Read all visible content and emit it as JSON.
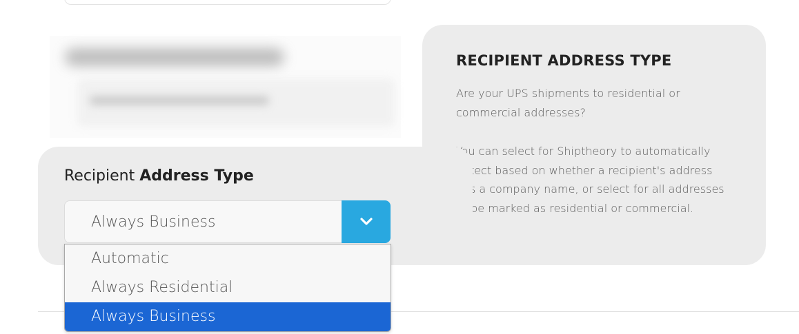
{
  "help": {
    "title": "RECIPIENT ADDRESS TYPE",
    "paragraph1": "Are your UPS shipments to residential or commercial addresses?",
    "paragraph2": "You can select for Shiptheory to automatically detect based on whether a recipient's address has a company name, or select for all addresses to be marked as residential or commercial."
  },
  "field": {
    "label_regular": "Recipient ",
    "label_bold": "Address Type",
    "selected_value": "Always Business",
    "options": [
      "Automatic",
      "Always Residential",
      "Always Business"
    ],
    "highlighted_option": "Always Business"
  },
  "colors": {
    "dropdown_button": "#29a8e0",
    "option_highlight": "#1b66d4",
    "card_background": "#ececec"
  },
  "icons": {
    "dropdown": "chevron-down-icon"
  }
}
